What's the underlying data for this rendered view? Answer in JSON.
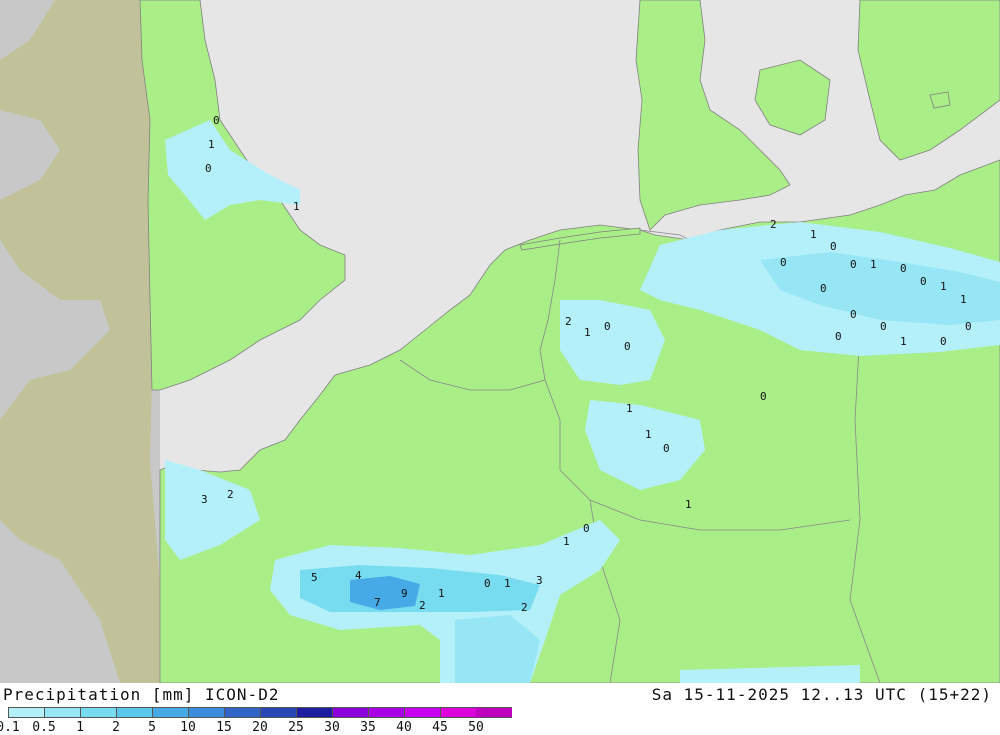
{
  "map": {
    "colors": {
      "sea": "#e6e6e6",
      "land": "#aaee88",
      "outside_domain": "#c8c8c8",
      "outside_land": "#c2c29a",
      "border": "#888888",
      "coast": "#808080"
    },
    "value_labels": [
      "0",
      "1",
      "0",
      "1",
      "2",
      "3",
      "5",
      "4",
      "9",
      "7",
      "2",
      "1",
      "0",
      "1",
      "2",
      "3",
      "1",
      "0",
      "2",
      "1",
      "0",
      "0",
      "1",
      "1",
      "0",
      "1",
      "2",
      "1",
      "0",
      "0",
      "1",
      "0",
      "0",
      "1",
      "1",
      "0",
      "0",
      "0",
      "0",
      "1",
      "0",
      "0",
      "0",
      "0"
    ]
  },
  "footer": {
    "title": "Precipitation [mm] ICON-D2",
    "run": "Sa 15-11-2025 12..13 UTC (15+22)",
    "legend": {
      "ticks": [
        "0.1",
        "0.5",
        "1",
        "2",
        "5",
        "10",
        "15",
        "20",
        "25",
        "30",
        "35",
        "40",
        "45",
        "50"
      ],
      "colors": [
        "#b4f0fa",
        "#96e6f5",
        "#78dcf0",
        "#5ac8eb",
        "#46aae6",
        "#3c8cdc",
        "#3264c8",
        "#2846b4",
        "#1e1ea0",
        "#8c00dc",
        "#aa00e6",
        "#c800f0",
        "#dc00dc",
        "#be00be"
      ]
    }
  }
}
